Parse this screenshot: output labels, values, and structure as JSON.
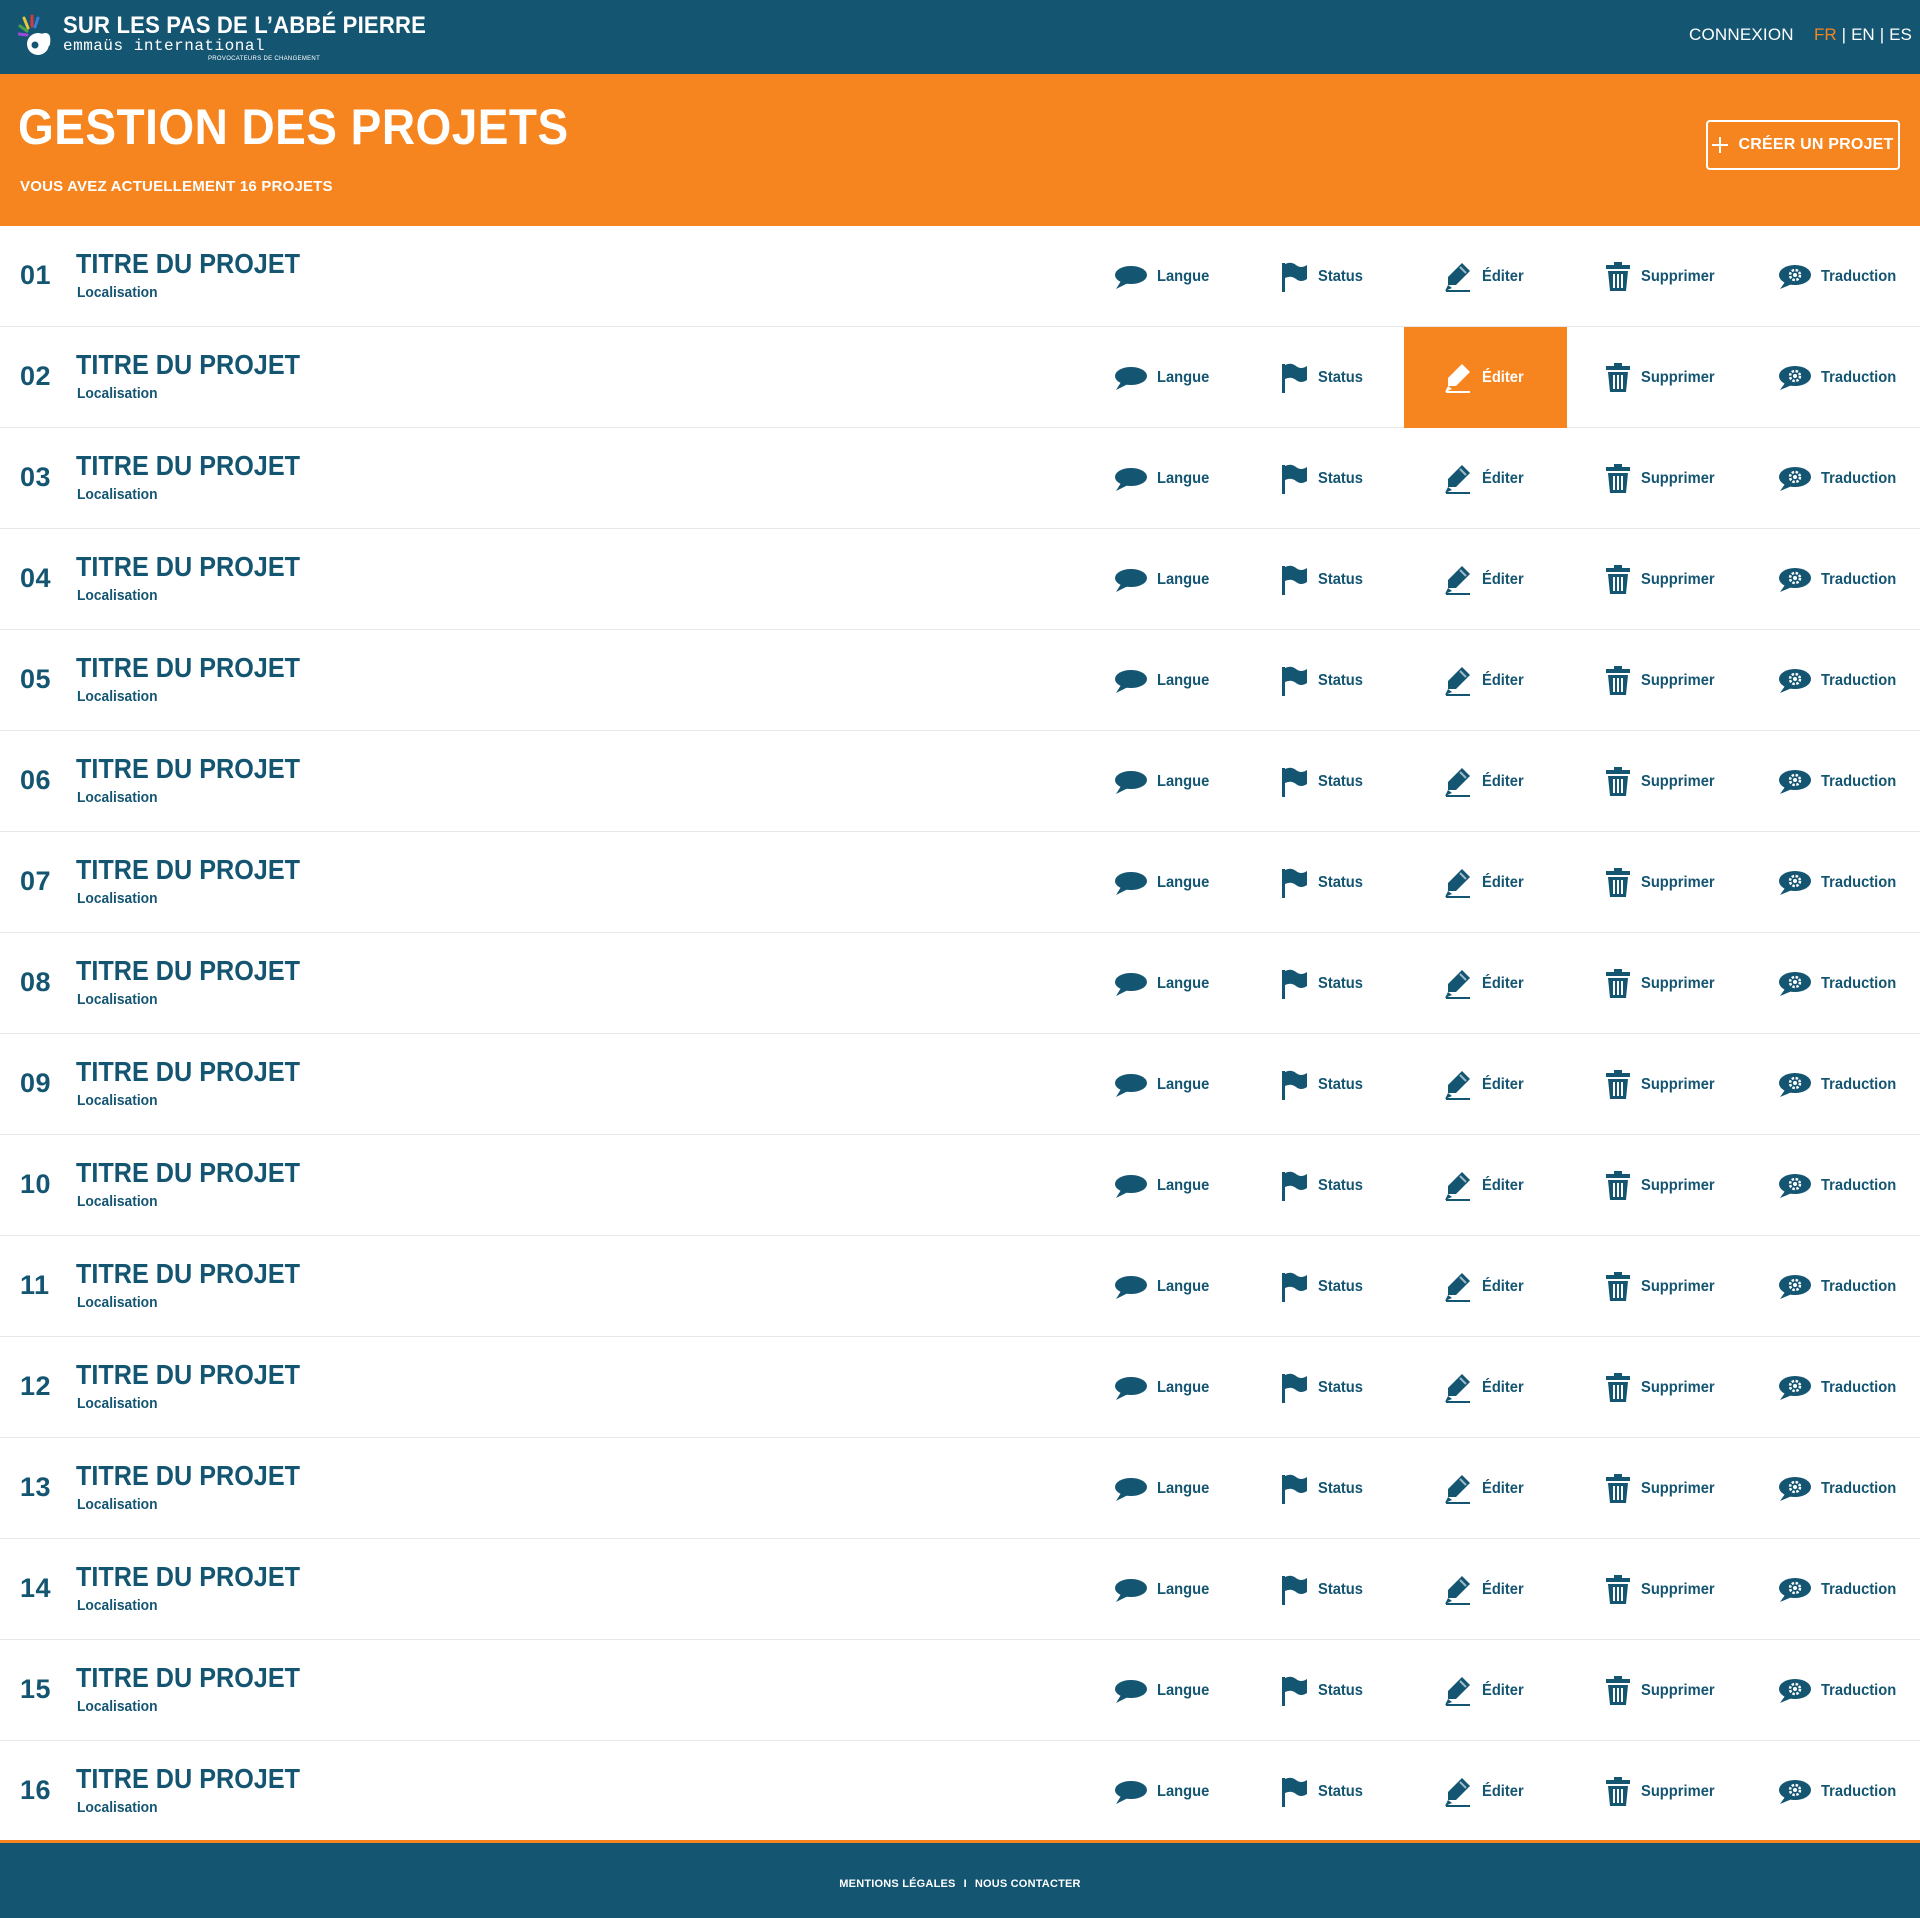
{
  "brand": {
    "title": "SUR LES PAS DE L’ABBÉ PIERRE",
    "subtitle": "emmaüs international",
    "tagline": "PROVOCATEURS DE CHANGEMENT"
  },
  "nav": {
    "login": "CONNEXION",
    "languages": [
      "FR",
      "EN",
      "ES"
    ],
    "active_language": "FR",
    "separator": "|"
  },
  "header": {
    "title": "GESTION DES PROJETS",
    "subtitle": "VOUS AVEZ ACTUELLEMENT 16 PROJETS",
    "create_label": "CRÉER UN PROJET"
  },
  "actions": {
    "langue": "Langue",
    "status": "Status",
    "edit": "Éditer",
    "delete": "Supprimer",
    "translate": "Traduction"
  },
  "projects": [
    {
      "num": "01",
      "title": "TITRE DU PROJET",
      "location": "Localisation"
    },
    {
      "num": "02",
      "title": "TITRE DU PROJET",
      "location": "Localisation",
      "edit_active": true
    },
    {
      "num": "03",
      "title": "TITRE DU PROJET",
      "location": "Localisation"
    },
    {
      "num": "04",
      "title": "TITRE DU PROJET",
      "location": "Localisation"
    },
    {
      "num": "05",
      "title": "TITRE DU PROJET",
      "location": "Localisation"
    },
    {
      "num": "06",
      "title": "TITRE DU PROJET",
      "location": "Localisation"
    },
    {
      "num": "07",
      "title": "TITRE DU PROJET",
      "location": "Localisation"
    },
    {
      "num": "08",
      "title": "TITRE DU PROJET",
      "location": "Localisation"
    },
    {
      "num": "09",
      "title": "TITRE DU PROJET",
      "location": "Localisation"
    },
    {
      "num": "10",
      "title": "TITRE DU PROJET",
      "location": "Localisation"
    },
    {
      "num": "11",
      "title": "TITRE DU PROJET",
      "location": "Localisation"
    },
    {
      "num": "12",
      "title": "TITRE DU PROJET",
      "location": "Localisation"
    },
    {
      "num": "13",
      "title": "TITRE DU PROJET",
      "location": "Localisation"
    },
    {
      "num": "14",
      "title": "TITRE DU PROJET",
      "location": "Localisation"
    },
    {
      "num": "15",
      "title": "TITRE DU PROJET",
      "location": "Localisation"
    },
    {
      "num": "16",
      "title": "TITRE DU PROJET",
      "location": "Localisation"
    }
  ],
  "footer": {
    "legal": "MENTIONS LÉGALES",
    "contact": "NOUS CONTACTER",
    "separator": "I"
  },
  "colors": {
    "primary": "#145572",
    "accent": "#f6851f",
    "background": "#ffffff"
  },
  "icons": {
    "langue": "speech-bubble-icon",
    "status": "flag-icon",
    "edit": "pencil-icon",
    "delete": "trash-icon",
    "translate": "gear-bubble-icon",
    "create": "plus-icon"
  }
}
